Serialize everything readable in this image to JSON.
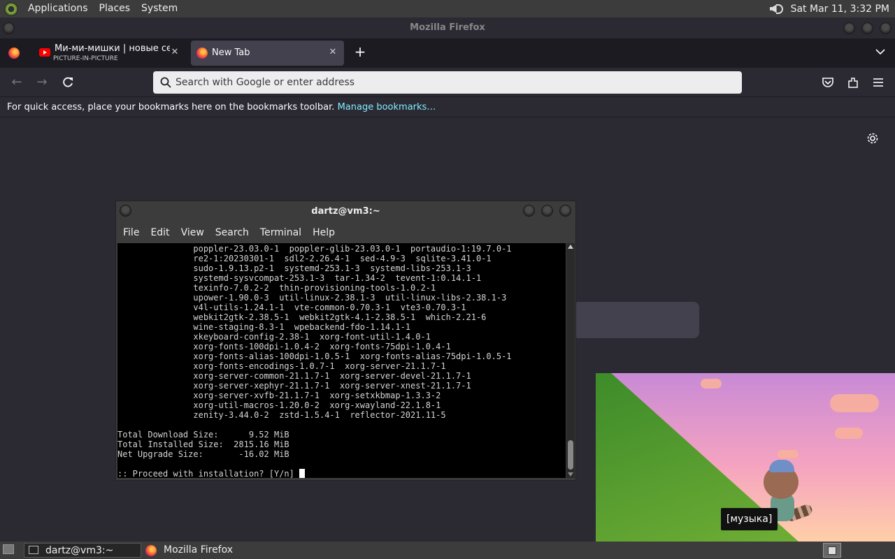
{
  "top_panel": {
    "menus": [
      "Applications",
      "Places",
      "System"
    ],
    "clock": "Sat Mar 11,  3:32 PM"
  },
  "firefox": {
    "window_title": "Mozilla Firefox",
    "tabs": [
      {
        "title": "Ми-ми-мишки | новые серии",
        "subtitle": "PICTURE-IN-PICTURE",
        "icon": "youtube-icon"
      },
      {
        "title": "New Tab",
        "icon": "firefox-icon"
      }
    ],
    "urlbar_placeholder": "Search with Google or enter address",
    "bookmarks_text": "For quick access, place your bookmarks here on the bookmarks toolbar.",
    "bookmarks_link": "Manage bookmarks…"
  },
  "terminal": {
    "title": "dartz@vm3:~",
    "menus": [
      "File",
      "Edit",
      "View",
      "Search",
      "Terminal",
      "Help"
    ],
    "lines": [
      "               poppler-23.03.0-1  poppler-glib-23.03.0-1  portaudio-1:19.7.0-1",
      "               re2-1:20230301-1  sdl2-2.26.4-1  sed-4.9-3  sqlite-3.41.0-1",
      "               sudo-1.9.13.p2-1  systemd-253.1-3  systemd-libs-253.1-3",
      "               systemd-sysvcompat-253.1-3  tar-1.34-2  tevent-1:0.14.1-1",
      "               texinfo-7.0.2-2  thin-provisioning-tools-1.0.2-1",
      "               upower-1.90.0-3  util-linux-2.38.1-3  util-linux-libs-2.38.1-3",
      "               v4l-utils-1.24.1-1  vte-common-0.70.3-1  vte3-0.70.3-1",
      "               webkit2gtk-2.38.5-1  webkit2gtk-4.1-2.38.5-1  which-2.21-6",
      "               wine-staging-8.3-1  wpebackend-fdo-1.14.1-1",
      "               xkeyboard-config-2.38-1  xorg-font-util-1.4.0-1",
      "               xorg-fonts-100dpi-1.0.4-2  xorg-fonts-75dpi-1.0.4-1",
      "               xorg-fonts-alias-100dpi-1.0.5-1  xorg-fonts-alias-75dpi-1.0.5-1",
      "               xorg-fonts-encodings-1.0.7-1  xorg-server-21.1.7-1",
      "               xorg-server-common-21.1.7-1  xorg-server-devel-21.1.7-1",
      "               xorg-server-xephyr-21.1.7-1  xorg-server-xnest-21.1.7-1",
      "               xorg-server-xvfb-21.1.7-1  xorg-setxkbmap-1.3.3-2",
      "               xorg-util-macros-1.20.0-2  xorg-xwayland-22.1.8-1",
      "               zenity-3.44.0-2  zstd-1.5.4-1  reflector-2021.11-5",
      "",
      "Total Download Size:      9.52 MiB",
      "Total Installed Size:  2815.16 MiB",
      "Net Upgrade Size:       -16.02 MiB",
      ""
    ],
    "prompt": ":: Proceed with installation? [Y/n] "
  },
  "pip": {
    "subtitle": "[музыка]"
  },
  "bottom_panel": {
    "tasks": [
      "dartz@vm3:~",
      "Mozilla Firefox"
    ]
  }
}
